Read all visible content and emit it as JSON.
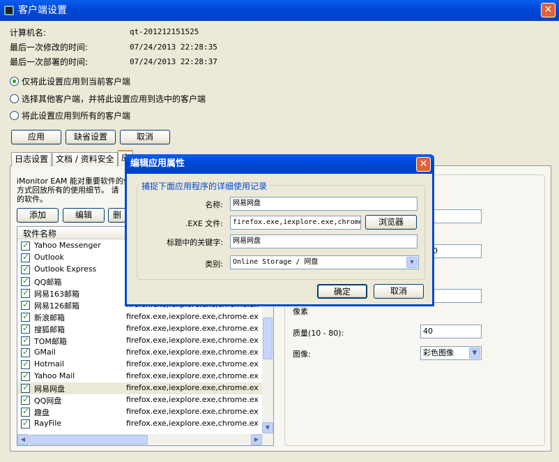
{
  "window": {
    "title": "客户端设置",
    "close": "✕"
  },
  "info": [
    {
      "label": "计算机名:",
      "value": "qt-201212151525"
    },
    {
      "label": "最后一次修改的时间:",
      "value": "07/24/2013 22:28:35"
    },
    {
      "label": "最后一次部署的时间:",
      "value": "07/24/2013 22:28:37"
    }
  ],
  "radios": [
    {
      "label": "仅将此设置应用到当前客户端",
      "checked": true
    },
    {
      "label": "选择其他客户端，并将此设置应用到选中的客户端",
      "checked": false
    },
    {
      "label": "将此设置应用到所有的客户端",
      "checked": false
    }
  ],
  "buttons": {
    "apply": "应用",
    "defaults": "缺省设置",
    "cancel": "取消"
  },
  "tabs": [
    "日志设置",
    "文档 / 资料安全",
    "应"
  ],
  "panel": {
    "desc1": "iMonitor EAM 能对重要软件的使",
    "desc2": "方式回放所有的使用细节。 请",
    "desc3": "的软件。",
    "add": "添加",
    "edit": "编辑",
    "delete": "删",
    "col_name": "软件名称",
    "rows": [
      {
        "name": "Yahoo Messenger",
        "file": ""
      },
      {
        "name": "Outlook",
        "file": ""
      },
      {
        "name": "Outlook Express",
        "file": ""
      },
      {
        "name": "QQ邮箱",
        "file": ""
      },
      {
        "name": "网易163邮箱",
        "file": ""
      },
      {
        "name": "网易126邮箱",
        "file": "firefox.exe,iexplore.exe,chrome.exe,o..."
      },
      {
        "name": "新浪邮箱",
        "file": "firefox.exe,iexplore.exe,chrome.exe,o..."
      },
      {
        "name": "搜狐邮箱",
        "file": "firefox.exe,iexplore.exe,chrome.exe,o..."
      },
      {
        "name": "TOM邮箱",
        "file": "firefox.exe,iexplore.exe,chrome.exe,o..."
      },
      {
        "name": "GMail",
        "file": "firefox.exe,iexplore.exe,chrome.exe,o..."
      },
      {
        "name": "Hotmail",
        "file": "firefox.exe,iexplore.exe,chrome.exe,o..."
      },
      {
        "name": "Yahoo Mail",
        "file": "firefox.exe,iexplore.exe,chrome.exe,o..."
      },
      {
        "name": "网易网盘",
        "file": "firefox.exe,iexplore.exe,chrome.exe,o..."
      },
      {
        "name": "QQ网盘",
        "file": "firefox.exe,iexplore.exe,chrome.exe,o..."
      },
      {
        "name": "趣盘",
        "file": "firefox.exe,iexplore.exe,chrome.exe,o..."
      },
      {
        "name": "RayFile",
        "file": "firefox.exe,iexplore.exe,chrome.exe,o..."
      }
    ],
    "selected_row": "网易网盘"
  },
  "right": {
    "field1": "",
    "field2": "000",
    "field3": "0",
    "pixel_label": "像素",
    "quality_label": "质量(10 - 80):",
    "quality_value": "40",
    "image_label": "图像:",
    "image_value": "彩色图像"
  },
  "dialog": {
    "title": "编辑应用属性",
    "group_title": "捕捉下面应用程序的详细使用记录",
    "name_label": "名称:",
    "name_value": "网易网盘",
    "exe_label": ".EXE 文件:",
    "exe_value": "firefox.exe,iexplore.exe,chrome",
    "browse": "浏览器",
    "keyword_label": "标题中的关键字:",
    "keyword_value": "网易网盘",
    "category_label": "类别:",
    "category_value": "Online Storage / 网盘",
    "ok": "确定",
    "cancel": "取消",
    "close": "✕"
  }
}
